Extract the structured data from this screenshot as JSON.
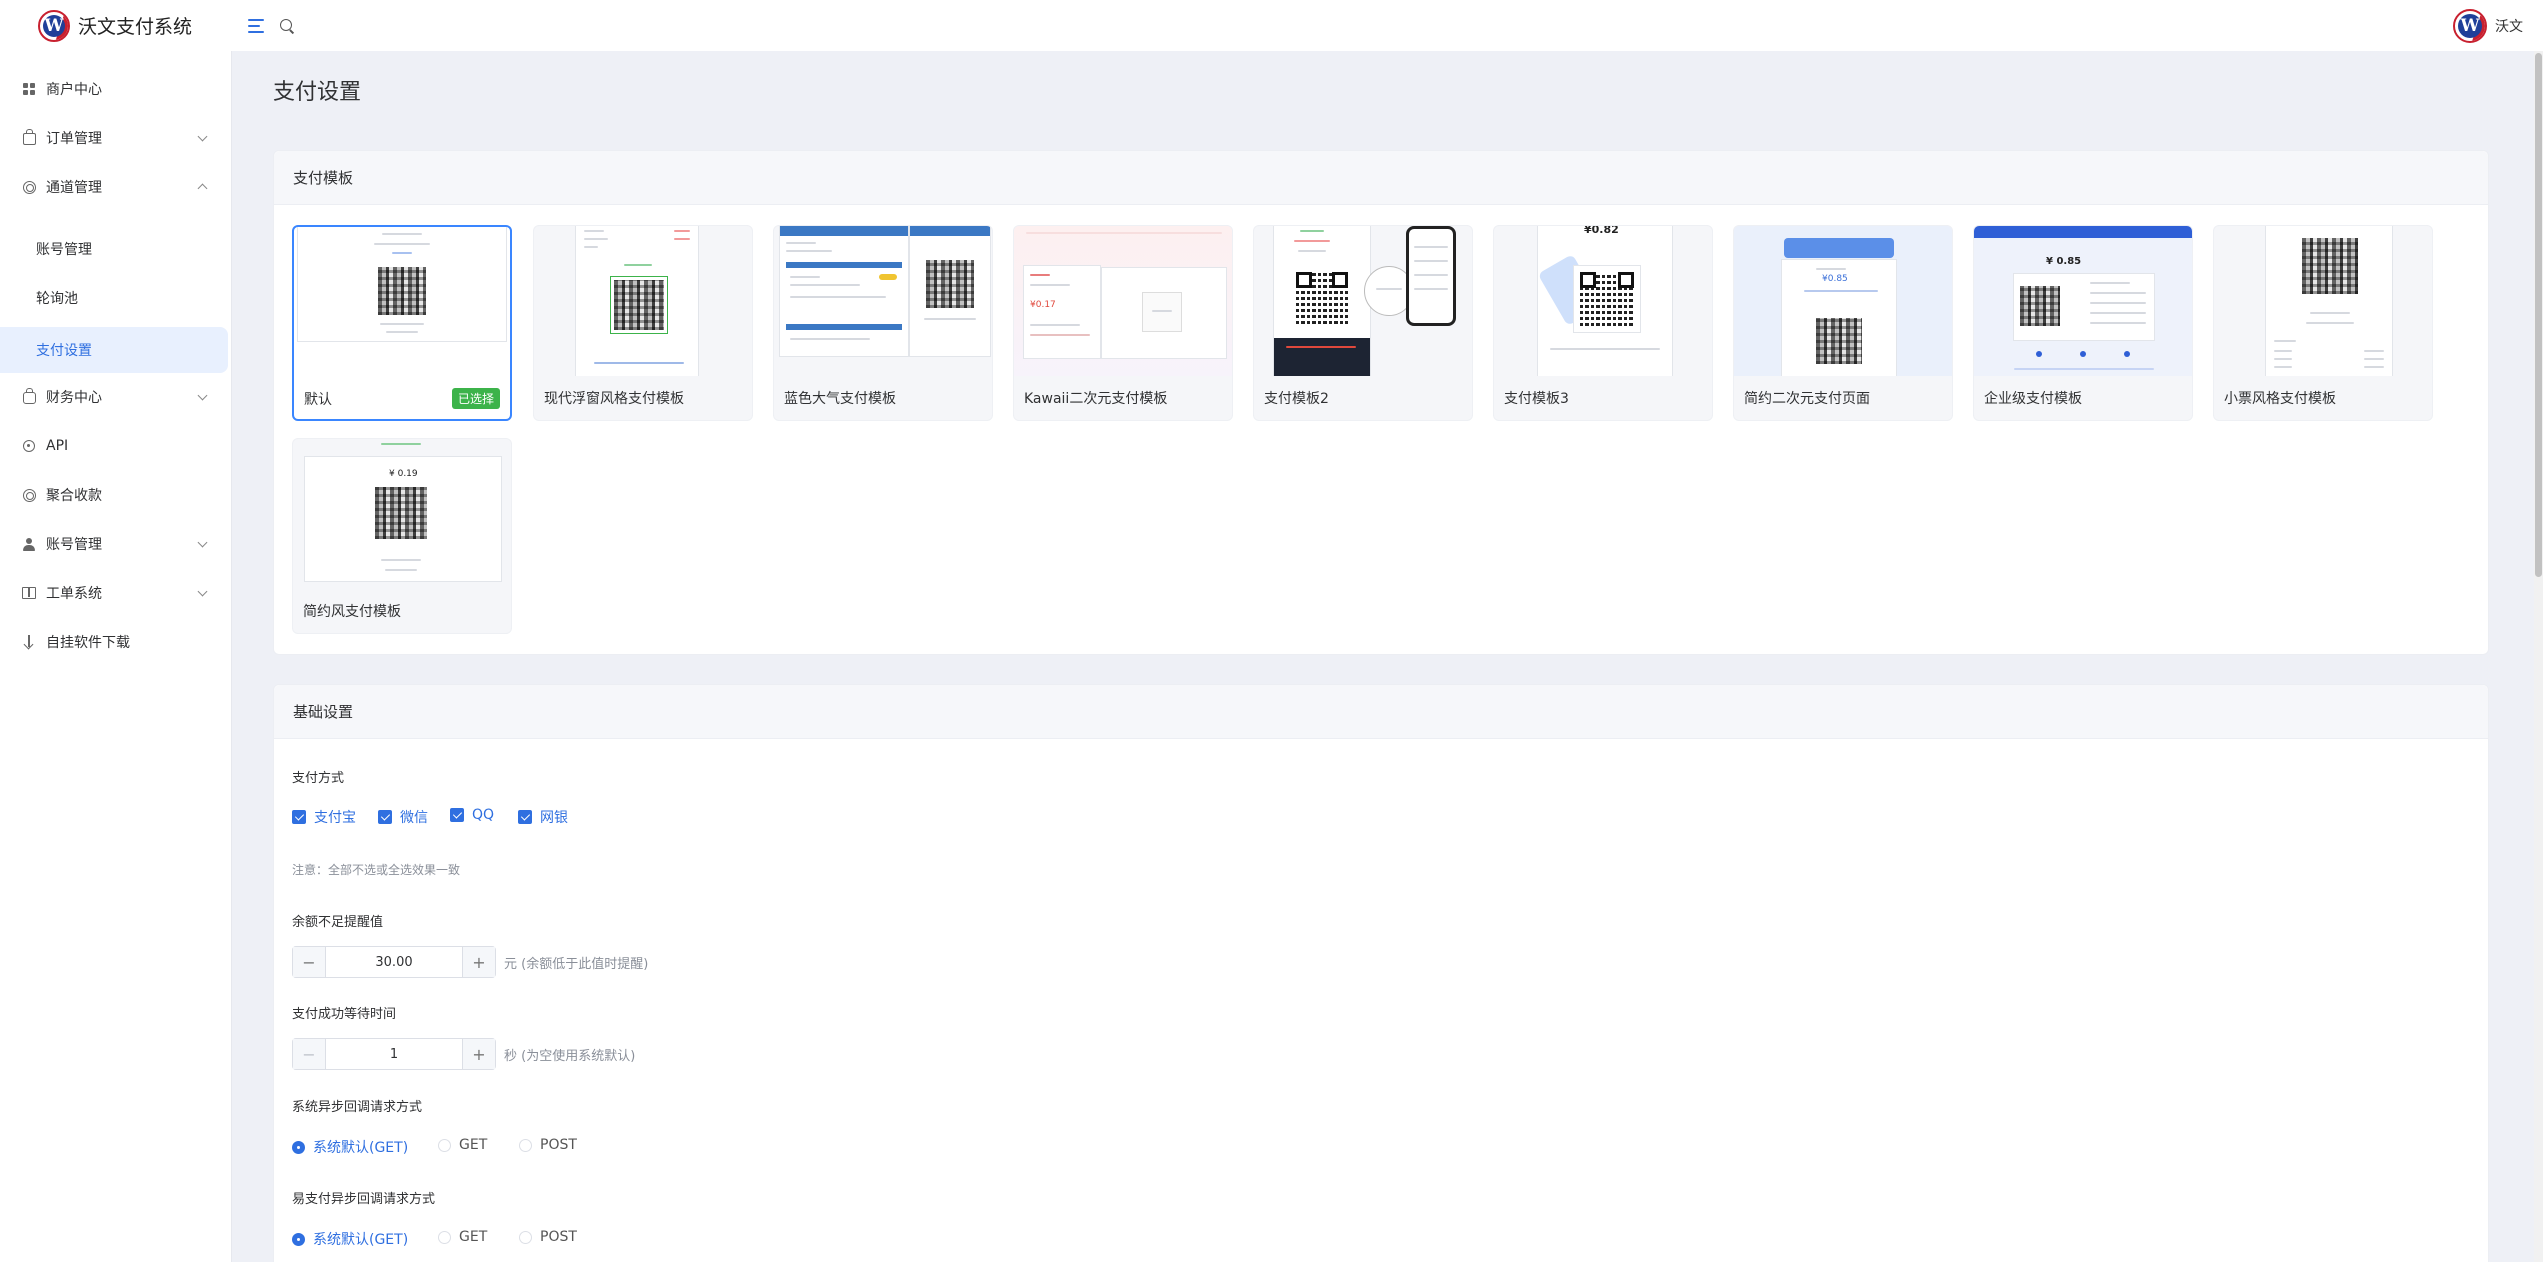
{
  "header": {
    "app_title": "沃文支付系统",
    "user_name": "沃文"
  },
  "sidebar": {
    "items": [
      {
        "label": "商户中心",
        "icon": "grid-icon"
      },
      {
        "label": "订单管理",
        "icon": "bag-icon"
      },
      {
        "label": "通道管理",
        "icon": "channel-icon"
      },
      {
        "label": "账号管理",
        "icon": ""
      },
      {
        "label": "轮询池",
        "icon": ""
      },
      {
        "label": "支付设置",
        "icon": ""
      },
      {
        "label": "财务中心",
        "icon": "finance-icon"
      },
      {
        "label": "API",
        "icon": "api-icon"
      },
      {
        "label": "聚合收款",
        "icon": "aggregate-icon"
      },
      {
        "label": "账号管理",
        "icon": "user-icon"
      },
      {
        "label": "工单系统",
        "icon": "book-icon"
      },
      {
        "label": "自挂软件下载",
        "icon": "download-icon"
      }
    ]
  },
  "page": {
    "title": "支付设置"
  },
  "templates_card": {
    "title": "支付模板",
    "selected_badge": "已选择",
    "items": [
      {
        "name": "默认",
        "selected": true
      },
      {
        "name": "现代浮窗风格支付模板"
      },
      {
        "name": "蓝色大气支付模板"
      },
      {
        "name": "Kawaii二次元支付模板"
      },
      {
        "name": "支付模板2"
      },
      {
        "name": "支付模板3"
      },
      {
        "name": "简约二次元支付页面"
      },
      {
        "name": "企业级支付模板"
      },
      {
        "name": "小票风格支付模板"
      },
      {
        "name": "简约风支付模板"
      }
    ],
    "thumb_text": {
      "t3_amount": "¥0.17",
      "t6_amount": "¥0.82",
      "t7_amount": "¥0.85",
      "t8_amount": "¥ 0.85",
      "t10_amount": "¥ 0.19"
    }
  },
  "basic_card": {
    "title": "基础设置",
    "pay_method": {
      "label": "支付方式",
      "options": [
        "支付宝",
        "微信",
        "QQ",
        "网银"
      ],
      "note": "注意：全部不选或全选效果一致"
    },
    "balance_alert": {
      "label": "余额不足提醒值",
      "value": "30.00",
      "unit": "元 (余额低于此值时提醒)"
    },
    "wait_time": {
      "label": "支付成功等待时间",
      "value": "1",
      "unit": "秒 (为空使用系统默认)"
    },
    "sys_callback": {
      "label": "系统异步回调请求方式",
      "options": [
        "系统默认(GET)",
        "GET",
        "POST"
      ],
      "selected": 0
    },
    "epay_callback": {
      "label": "易支付异步回调请求方式",
      "options": [
        "系统默认(GET)",
        "GET",
        "POST"
      ],
      "selected": 0
    }
  }
}
